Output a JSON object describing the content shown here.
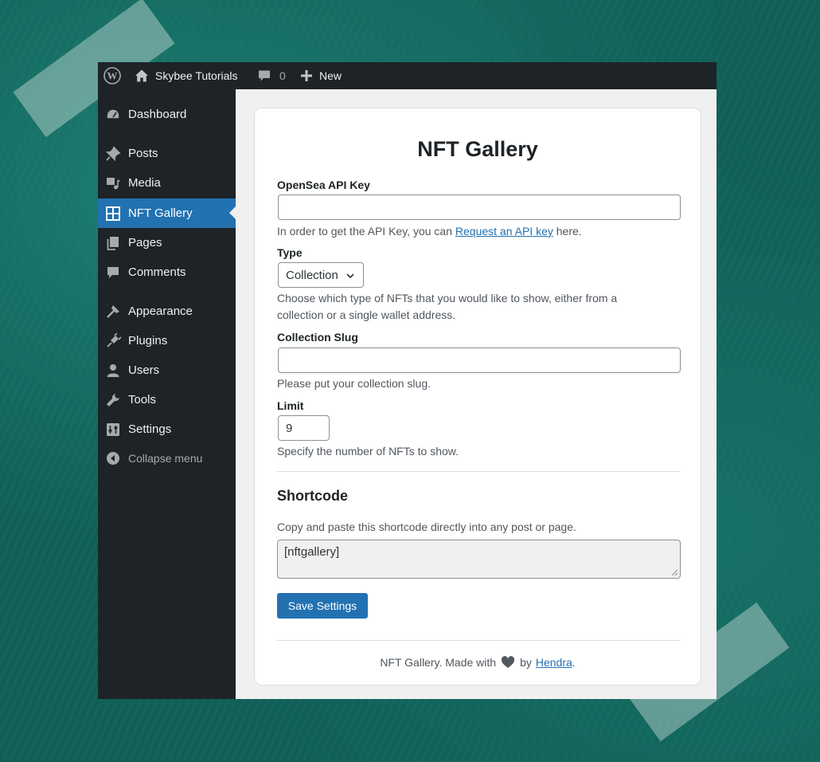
{
  "adminbar": {
    "site_name": "Skybee Tutorials",
    "comments_count": "0",
    "new_label": "New"
  },
  "sidebar": {
    "items": [
      {
        "label": "Dashboard",
        "icon": "dashboard-icon"
      },
      {
        "label": "Posts",
        "icon": "pin-icon"
      },
      {
        "label": "Media",
        "icon": "media-icon"
      },
      {
        "label": "NFT Gallery",
        "icon": "grid-icon",
        "active": true
      },
      {
        "label": "Pages",
        "icon": "pages-icon"
      },
      {
        "label": "Comments",
        "icon": "comment-icon"
      },
      {
        "label": "Appearance",
        "icon": "brush-icon"
      },
      {
        "label": "Plugins",
        "icon": "plug-icon"
      },
      {
        "label": "Users",
        "icon": "user-icon"
      },
      {
        "label": "Tools",
        "icon": "wrench-icon"
      },
      {
        "label": "Settings",
        "icon": "settings-icon"
      }
    ],
    "collapse_label": "Collapse menu"
  },
  "page": {
    "title": "NFT Gallery",
    "api_key": {
      "label": "OpenSea API Key",
      "value": "",
      "help_prefix": "In order to get the API Key, you can ",
      "help_link": "Request an API key",
      "help_suffix": " here."
    },
    "type": {
      "label": "Type",
      "selected": "Collection",
      "help": "Choose which type of NFTs that you would like to show, either from a collection or a single wallet address."
    },
    "slug": {
      "label": "Collection Slug",
      "value": "",
      "help": "Please put your collection slug."
    },
    "limit": {
      "label": "Limit",
      "value": "9",
      "help": "Specify the number of NFTs to show."
    },
    "shortcode": {
      "title": "Shortcode",
      "help": "Copy and paste this shortcode directly into any post or page.",
      "value": "[nftgallery]"
    },
    "save_label": "Save Settings",
    "footer": {
      "prefix": "NFT Gallery. Made with",
      "by": "by",
      "author": "Hendra",
      "suffix": "."
    }
  },
  "colors": {
    "admin_dark": "#1d2327",
    "accent_blue": "#2271b1",
    "background_teal": "#0f5f56"
  }
}
